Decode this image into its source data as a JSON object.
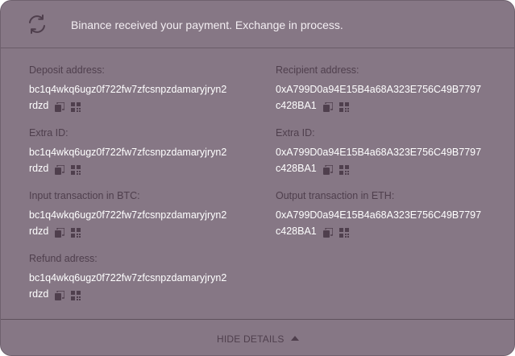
{
  "status": {
    "message": "Binance received your payment. Exchange in process."
  },
  "icons": {
    "status": "refresh-icon",
    "copy": "copy-icon",
    "qr": "qr-code-icon",
    "toggle": "caret-up-icon"
  },
  "colors": {
    "panel": "#867785",
    "label": "#4f3f4d",
    "value": "#ffffff",
    "icon": "#4f3f4d"
  },
  "left_fields": [
    {
      "label": "Deposit address:",
      "value_line1": "bc1q4wkq6ugz0f722fw7zfcsnpzdamaryjryn2",
      "value_line2": "rdzd"
    },
    {
      "label": "Extra ID:",
      "value_line1": "bc1q4wkq6ugz0f722fw7zfcsnpzdamaryjryn2",
      "value_line2": "rdzd"
    },
    {
      "label": "Input transaction in BTC:",
      "value_line1": "bc1q4wkq6ugz0f722fw7zfcsnpzdamaryjryn2",
      "value_line2": "rdzd"
    },
    {
      "label": "Refund adress:",
      "value_line1": "bc1q4wkq6ugz0f722fw7zfcsnpzdamaryjryn2",
      "value_line2": "rdzd"
    }
  ],
  "right_fields": [
    {
      "label": "Recipient address:",
      "value_line1": "0xA799D0a94E15B4a68A323E756C49B7797",
      "value_line2": "c428BA1"
    },
    {
      "label": "Extra ID:",
      "value_line1": "0xA799D0a94E15B4a68A323E756C49B7797",
      "value_line2": "c428BA1"
    },
    {
      "label": "Output transaction in ETH:",
      "value_line1": "0xA799D0a94E15B4a68A323E756C49B7797",
      "value_line2": "c428BA1"
    }
  ],
  "footer": {
    "toggle_label": "HIDE DETAILS"
  }
}
